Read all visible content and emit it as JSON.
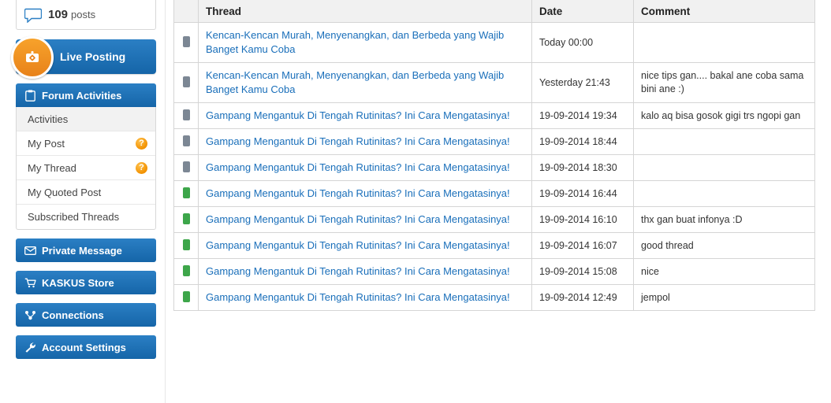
{
  "sidebar": {
    "posts_box": {
      "icon": "speech-bubble-icon",
      "count": "109",
      "label": "posts"
    },
    "live_posting": {
      "icon": "live-posting-badge-icon",
      "label": "Live Posting"
    },
    "forum_activities": {
      "icon": "clipboard-icon",
      "title": "Forum Activities",
      "items": [
        {
          "label": "Activities",
          "active": true,
          "badge": ""
        },
        {
          "label": "My Post",
          "active": false,
          "badge": "?"
        },
        {
          "label": "My Thread",
          "active": false,
          "badge": "?"
        },
        {
          "label": "My Quoted Post",
          "active": false,
          "badge": ""
        },
        {
          "label": "Subscribed Threads",
          "active": false,
          "badge": ""
        }
      ]
    },
    "menu_buttons": [
      {
        "label": "Private Message",
        "icon": "envelope-icon"
      },
      {
        "label": "KASKUS Store",
        "icon": "cart-icon"
      },
      {
        "label": "Connections",
        "icon": "connections-icon"
      },
      {
        "label": "Account Settings",
        "icon": "wrench-icon"
      }
    ]
  },
  "table": {
    "columns": [
      "Thread",
      "Date",
      "Comment"
    ],
    "rows": [
      {
        "status": "grey",
        "thread": "Kencan-Kencan Murah, Menyenangkan, dan Berbeda yang Wajib Banget Kamu Coba",
        "date": "Today 00:00",
        "comment": ""
      },
      {
        "status": "grey",
        "thread": "Kencan-Kencan Murah, Menyenangkan, dan Berbeda yang Wajib Banget Kamu Coba",
        "date": "Yesterday 21:43",
        "comment": "nice tips gan.... bakal ane coba sama bini ane :)"
      },
      {
        "status": "grey",
        "thread": "Gampang Mengantuk Di Tengah Rutinitas? Ini Cara Mengatasinya!",
        "date": "19-09-2014 19:34",
        "comment": "kalo aq bisa gosok gigi trs ngopi gan"
      },
      {
        "status": "grey",
        "thread": "Gampang Mengantuk Di Tengah Rutinitas? Ini Cara Mengatasinya!",
        "date": "19-09-2014 18:44",
        "comment": ""
      },
      {
        "status": "grey",
        "thread": "Gampang Mengantuk Di Tengah Rutinitas? Ini Cara Mengatasinya!",
        "date": "19-09-2014 18:30",
        "comment": ""
      },
      {
        "status": "green",
        "thread": "Gampang Mengantuk Di Tengah Rutinitas? Ini Cara Mengatasinya!",
        "date": "19-09-2014 16:44",
        "comment": ""
      },
      {
        "status": "green",
        "thread": "Gampang Mengantuk Di Tengah Rutinitas? Ini Cara Mengatasinya!",
        "date": "19-09-2014 16:10",
        "comment": "thx gan buat infonya :D"
      },
      {
        "status": "green",
        "thread": "Gampang Mengantuk Di Tengah Rutinitas? Ini Cara Mengatasinya!",
        "date": "19-09-2014 16:07",
        "comment": "good thread"
      },
      {
        "status": "green",
        "thread": "Gampang Mengantuk Di Tengah Rutinitas? Ini Cara Mengatasinya!",
        "date": "19-09-2014 15:08",
        "comment": "nice"
      },
      {
        "status": "green",
        "thread": "Gampang Mengantuk Di Tengah Rutinitas? Ini Cara Mengatasinya!",
        "date": "19-09-2014 12:49",
        "comment": "jempol"
      }
    ]
  },
  "colors": {
    "accent_blue": "#1565a8",
    "link_blue": "#1a6fba",
    "orange": "#f29100",
    "green": "#3da64a",
    "grey_dot": "#7c8794"
  }
}
